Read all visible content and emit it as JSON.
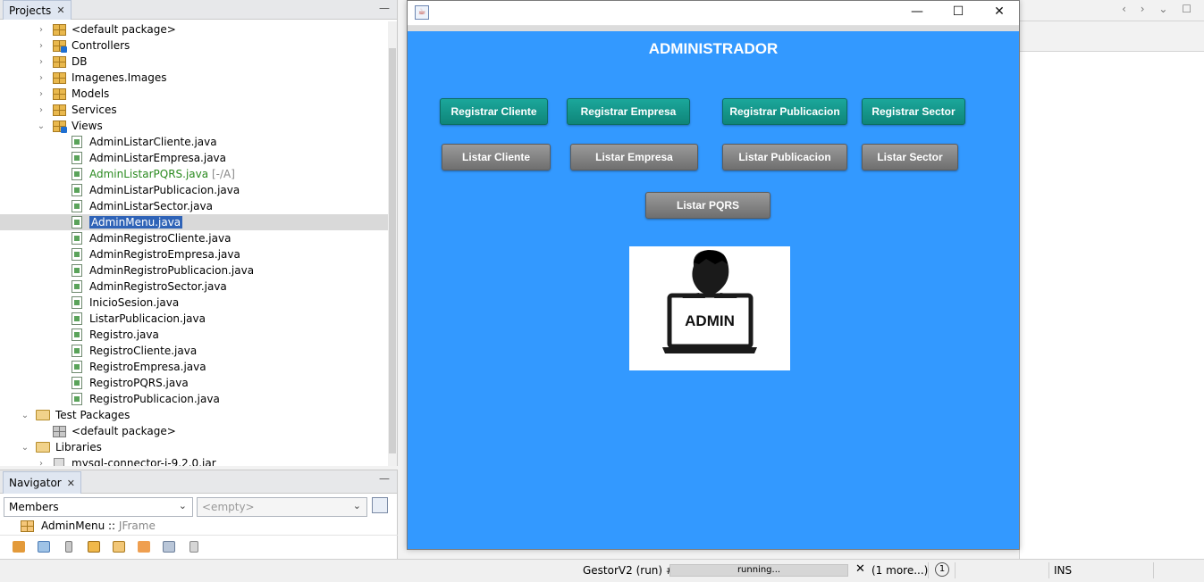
{
  "projects": {
    "tab_label": "Projects",
    "close_glyph": "✕",
    "minimize_glyph": "—",
    "tree": [
      {
        "label": "<default package>",
        "icon": "package-icon",
        "arrow": "›",
        "depth": 2
      },
      {
        "label": "Controllers",
        "icon": "package-icon",
        "arrow": "›",
        "depth": 2,
        "badge": true
      },
      {
        "label": "DB",
        "icon": "package-icon",
        "arrow": "›",
        "depth": 2
      },
      {
        "label": "Imagenes.Images",
        "icon": "package-icon",
        "arrow": "›",
        "depth": 2
      },
      {
        "label": "Models",
        "icon": "package-icon",
        "arrow": "›",
        "depth": 2
      },
      {
        "label": "Services",
        "icon": "package-icon",
        "arrow": "›",
        "depth": 2
      },
      {
        "label": "Views",
        "icon": "package-icon",
        "arrow": "⌄",
        "depth": 2,
        "badge": true
      },
      {
        "label": "AdminListarCliente.java",
        "icon": "java-file-icon",
        "depth": 3
      },
      {
        "label": "AdminListarEmpresa.java",
        "icon": "java-file-icon",
        "depth": 3
      },
      {
        "label": "AdminListarPQRS.java",
        "icon": "java-file-icon",
        "depth": 3,
        "modified": true,
        "suffix": "[-/A]"
      },
      {
        "label": "AdminListarPublicacion.java",
        "icon": "java-file-icon",
        "depth": 3
      },
      {
        "label": "AdminListarSector.java",
        "icon": "java-file-icon",
        "depth": 3
      },
      {
        "label": "AdminMenu.java",
        "icon": "java-file-icon",
        "depth": 3,
        "selected": true
      },
      {
        "label": "AdminRegistroCliente.java",
        "icon": "java-file-icon",
        "depth": 3
      },
      {
        "label": "AdminRegistroEmpresa.java",
        "icon": "java-file-icon",
        "depth": 3
      },
      {
        "label": "AdminRegistroPublicacion.java",
        "icon": "java-file-icon",
        "depth": 3
      },
      {
        "label": "AdminRegistroSector.java",
        "icon": "java-file-icon",
        "depth": 3
      },
      {
        "label": "InicioSesion.java",
        "icon": "java-file-icon",
        "depth": 3
      },
      {
        "label": "ListarPublicacion.java",
        "icon": "java-file-icon",
        "depth": 3
      },
      {
        "label": "Registro.java",
        "icon": "java-file-icon",
        "depth": 3
      },
      {
        "label": "RegistroCliente.java",
        "icon": "java-file-icon",
        "depth": 3
      },
      {
        "label": "RegistroEmpresa.java",
        "icon": "java-file-icon",
        "depth": 3
      },
      {
        "label": "RegistroPQRS.java",
        "icon": "java-file-icon",
        "depth": 3
      },
      {
        "label": "RegistroPublicacion.java",
        "icon": "java-file-icon",
        "depth": 3
      },
      {
        "label": "Test Packages",
        "icon": "folder-icon",
        "arrow": "⌄",
        "depth": 1
      },
      {
        "label": "<default package>",
        "icon": "package-gray-icon",
        "depth": 2
      },
      {
        "label": "Libraries",
        "icon": "folder-icon",
        "arrow": "⌄",
        "depth": 1
      },
      {
        "label": "mysql-connector-j-9.2.0.jar",
        "icon": "jar-icon",
        "arrow": "›",
        "depth": 2
      }
    ]
  },
  "navigator": {
    "tab_label": "Navigator",
    "close_glyph": "✕",
    "minimize_glyph": "—",
    "members_select": "Members",
    "filter_select": "<empty>",
    "root_item": "AdminMenu",
    "root_sep": " :: ",
    "root_type": "JFrame"
  },
  "window": {
    "title_icon": "java-icon",
    "minimize_glyph": "—",
    "maximize_glyph": "☐",
    "close_glyph": "✕",
    "heading": "ADMINISTRADOR",
    "register_buttons": [
      "Registrar Cliente",
      "Registrar Empresa",
      "Registrar Publicacion",
      "Registrar Sector"
    ],
    "list_buttons": [
      "Listar Cliente",
      "Listar Empresa",
      "Listar Publicacion",
      "Listar Sector"
    ],
    "pqrs_button": "Listar PQRS",
    "admin_image_text": "ADMIN",
    "colors": {
      "background": "#3399ff",
      "teal": "#11897d",
      "gray": "#7d7d7d"
    }
  },
  "editor": {
    "nav_glyphs": "‹ › ⌄ ☐"
  },
  "statusbar": {
    "run_label": "GestorV2 (run) #2",
    "progress_text": "running...",
    "cancel_glyph": "✕",
    "more_label": "(1 more...)",
    "notification_count": "1",
    "mode": "INS"
  }
}
